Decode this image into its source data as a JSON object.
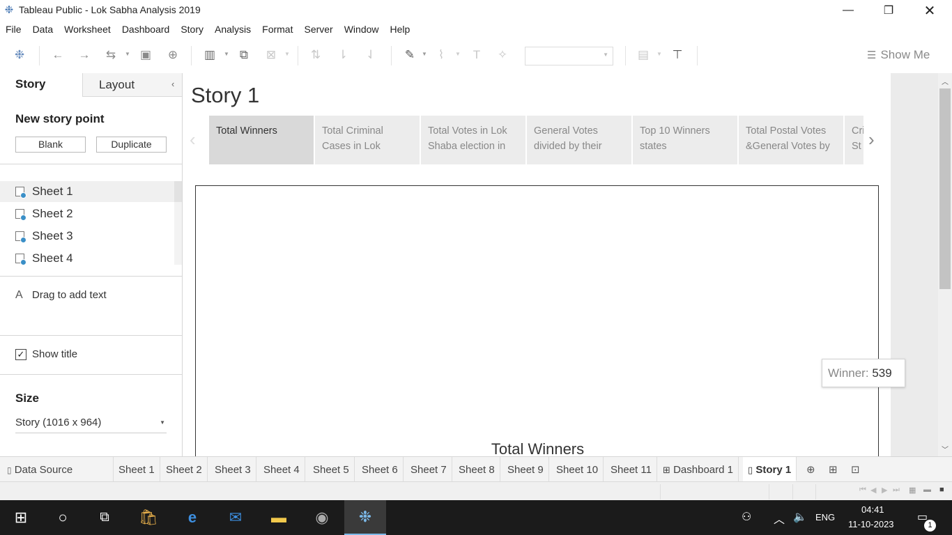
{
  "window": {
    "title": "Tableau Public - Lok Sabha Analysis 2019",
    "app_icon": "tableau-icon",
    "controls": [
      "minimize-icon",
      "maximize-icon",
      "close-icon"
    ]
  },
  "menu": [
    "File",
    "Data",
    "Worksheet",
    "Dashboard",
    "Story",
    "Analysis",
    "Format",
    "Server",
    "Window",
    "Help"
  ],
  "toolbar": {
    "show_me_label": "Show Me",
    "fit_select_value": ""
  },
  "left_pane": {
    "tabs": {
      "story": "Story",
      "layout": "Layout"
    },
    "new_story_point_title": "New story point",
    "blank_button": "Blank",
    "duplicate_button": "Duplicate",
    "sheets": [
      "Sheet 1",
      "Sheet 2",
      "Sheet 3",
      "Sheet 4"
    ],
    "selected_sheet": "Sheet 1",
    "drag_text_icon": "A",
    "drag_text_label": "Drag to add text",
    "show_title_label": "Show title",
    "show_title_checked": true,
    "size_title": "Size",
    "size_value": "Story (1016 x 964)"
  },
  "story": {
    "title": "Story 1",
    "points": [
      {
        "line1": "Total Winners",
        "line2": ""
      },
      {
        "line1": "Total Criminal",
        "line2": "Cases in Lok"
      },
      {
        "line1": "Total  Votes in Lok",
        "line2": "Shaba election in"
      },
      {
        "line1": "General Votes",
        "line2": "divided by their"
      },
      {
        "line1": "Top 10 Winners",
        "line2": "states"
      },
      {
        "line1": "Total Postal Votes",
        "line2": "&General Votes by"
      },
      {
        "line1": "Cri",
        "line2": "St"
      }
    ],
    "active_point": 0,
    "viz_title": "Total Winners",
    "tooltip": {
      "label": "Winner:",
      "value": "539"
    }
  },
  "bottom_tabs": {
    "data_source": "Data Source",
    "sheets": [
      "Sheet 1",
      "Sheet 2",
      "Sheet 3",
      "Sheet 4",
      "Sheet 5",
      "Sheet 6",
      "Sheet 7",
      "Sheet 8",
      "Sheet 9",
      "Sheet 10",
      "Sheet 11"
    ],
    "dashboard": "Dashboard 1",
    "story": "Story 1",
    "active": "Story 1"
  },
  "taskbar": {
    "language": "ENG",
    "time": "04:41",
    "date": "11-10-2023",
    "notification_count": "1"
  },
  "colors": {
    "accent": "#3a8fc7",
    "taskbar_bg": "#1b1b1b",
    "active_point_bg": "#d9d9d9"
  }
}
